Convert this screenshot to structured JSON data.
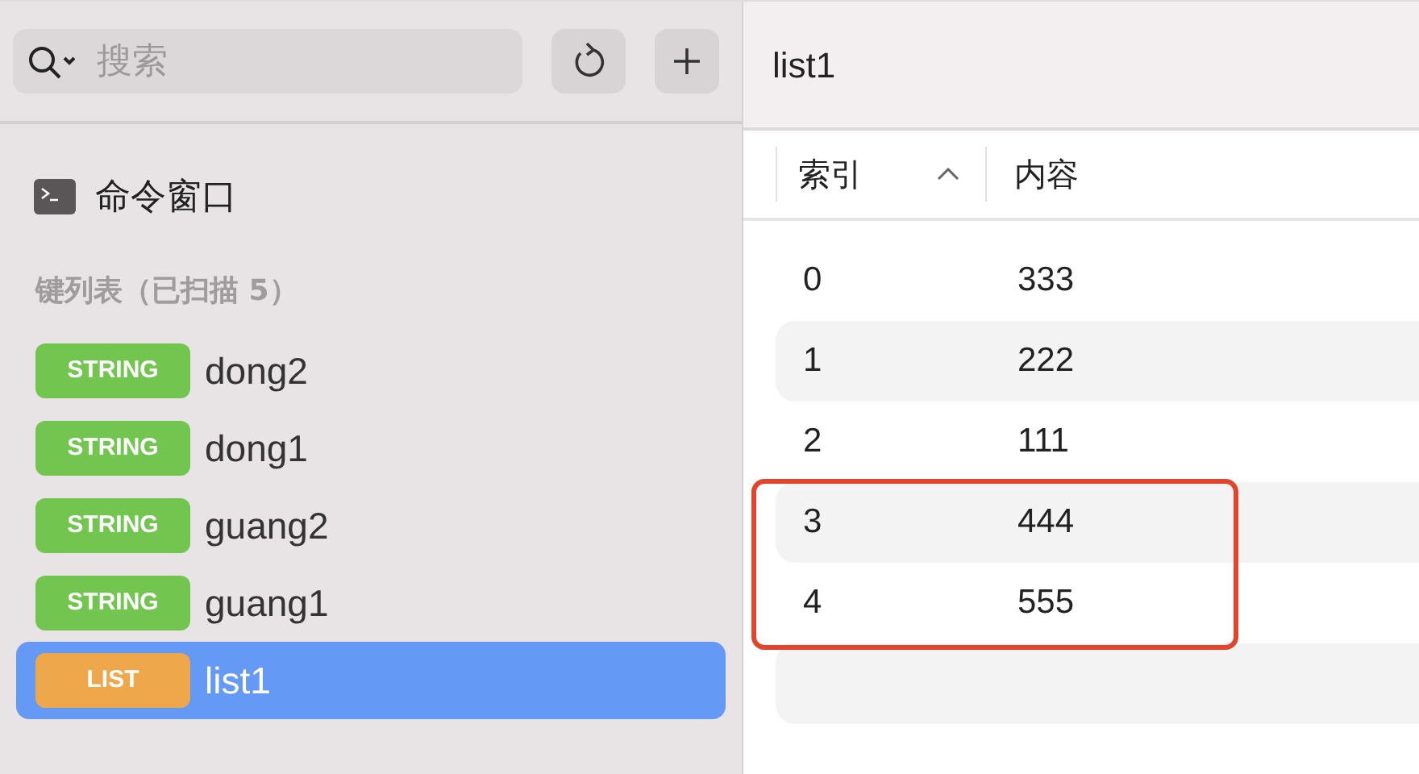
{
  "sidebar": {
    "search": {
      "placeholder": "搜索"
    },
    "console": {
      "label": "命令窗口"
    },
    "section_title": "键列表（已扫描 5）",
    "keys": [
      {
        "type": "STRING",
        "name": "dong2",
        "color": "#72c54f",
        "selected": false
      },
      {
        "type": "STRING",
        "name": "dong1",
        "color": "#72c54f",
        "selected": false
      },
      {
        "type": "STRING",
        "name": "guang2",
        "color": "#72c54f",
        "selected": false
      },
      {
        "type": "STRING",
        "name": "guang1",
        "color": "#72c54f",
        "selected": false
      },
      {
        "type": "LIST",
        "name": "list1",
        "color": "#eea74a",
        "selected": true
      }
    ]
  },
  "detail": {
    "title": "list1",
    "table": {
      "columns": [
        {
          "label": "索引",
          "sorted": true
        },
        {
          "label": "内容",
          "sorted": false
        }
      ],
      "rows": [
        {
          "cells": [
            "0",
            "333"
          ],
          "annotated": false
        },
        {
          "cells": [
            "1",
            "222"
          ],
          "annotated": false
        },
        {
          "cells": [
            "2",
            "111"
          ],
          "annotated": false
        },
        {
          "cells": [
            "3",
            "444"
          ],
          "annotated": true
        },
        {
          "cells": [
            "4",
            "555"
          ],
          "annotated": true
        }
      ]
    }
  }
}
